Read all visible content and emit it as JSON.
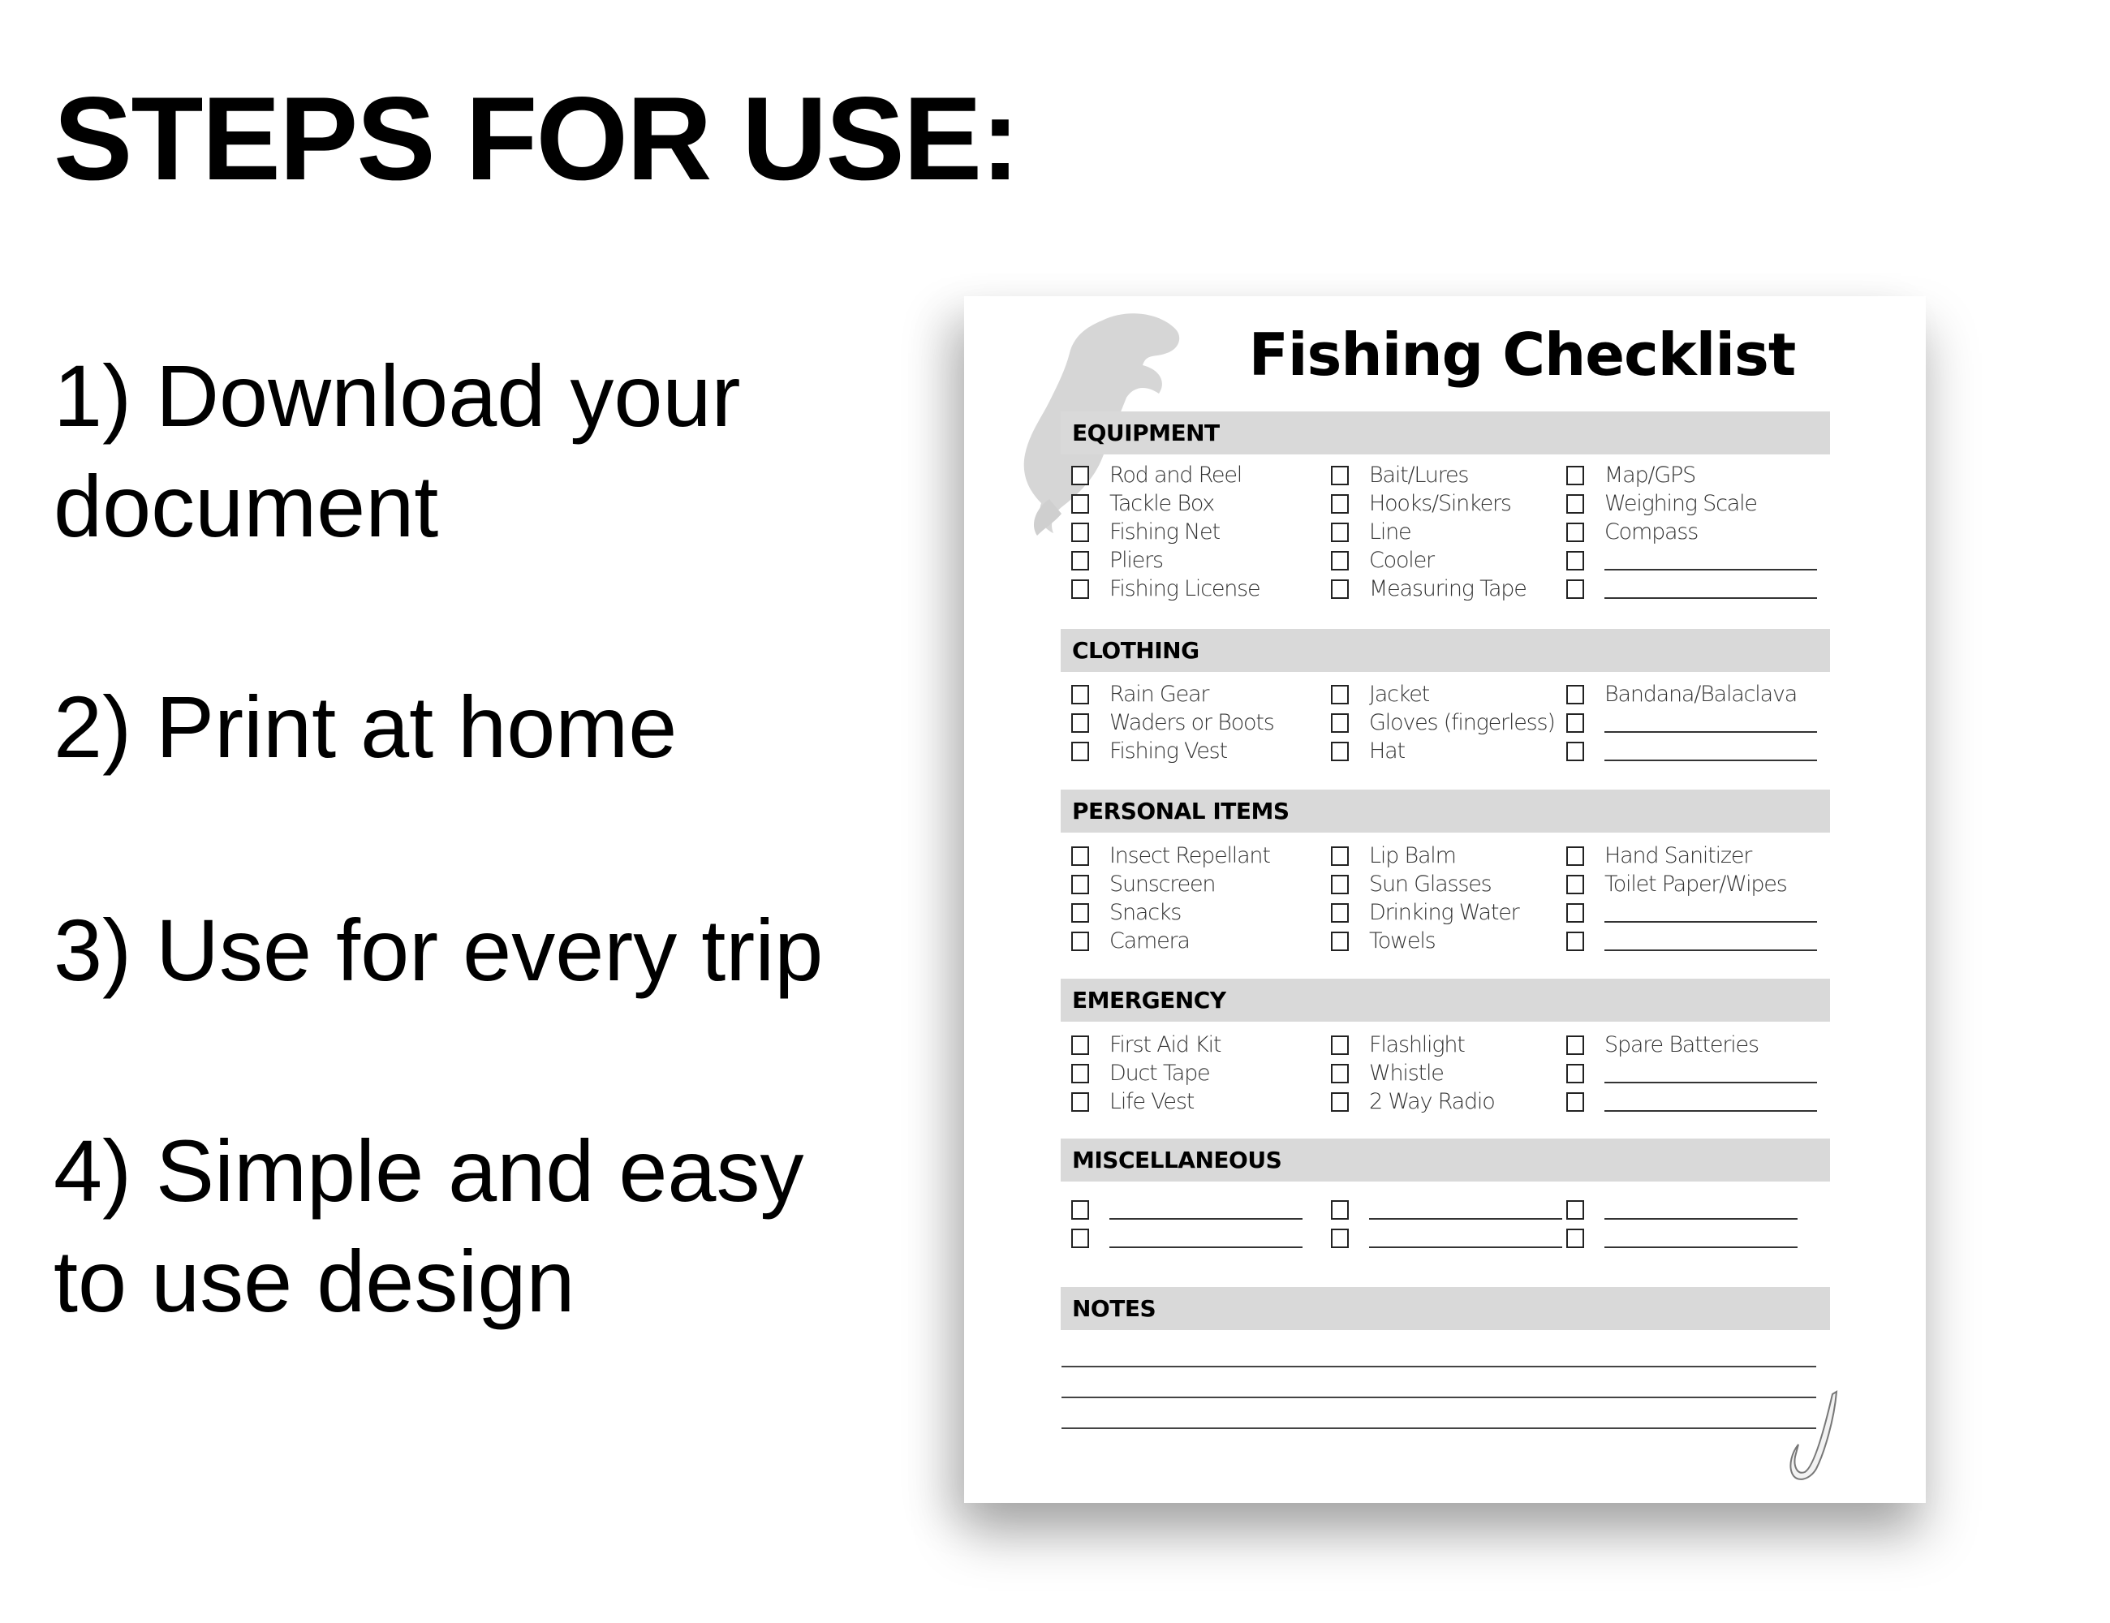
{
  "steps": {
    "title": "STEPS FOR USE:",
    "items": [
      {
        "line1": "1) Download your",
        "line2": "document"
      },
      {
        "line1": "2) Print at home",
        "line2": ""
      },
      {
        "line1": "3) Use for every trip",
        "line2": ""
      },
      {
        "line1": "4) Simple and easy",
        "line2": "to use design"
      }
    ]
  },
  "checklist": {
    "title": "Fishing Checklist",
    "sections": {
      "equipment": {
        "heading": "EQUIPMENT",
        "columns": [
          [
            "Rod and Reel",
            "Tackle Box",
            "Fishing Net",
            "Pliers",
            "Fishing License"
          ],
          [
            "Bait/Lures",
            "Hooks/Sinkers",
            "Line",
            "Cooler",
            "Measuring Tape"
          ],
          [
            "Map/GPS",
            "Weighing Scale",
            "Compass",
            "",
            ""
          ]
        ]
      },
      "clothing": {
        "heading": "CLOTHING",
        "columns": [
          [
            "Rain Gear",
            "Waders or Boots",
            "Fishing Vest"
          ],
          [
            "Jacket",
            "Gloves (fingerless)",
            "Hat"
          ],
          [
            "Bandana/Balaclava",
            "",
            ""
          ]
        ]
      },
      "personal": {
        "heading": "PERSONAL ITEMS",
        "columns": [
          [
            "Insect Repellant",
            "Sunscreen",
            "Snacks",
            "Camera"
          ],
          [
            "Lip Balm",
            "Sun Glasses",
            "Drinking Water",
            "Towels"
          ],
          [
            "Hand Sanitizer",
            "Toilet Paper/Wipes",
            "",
            ""
          ]
        ]
      },
      "emergency": {
        "heading": "EMERGENCY",
        "columns": [
          [
            "First Aid Kit",
            "Duct Tape",
            "Life Vest"
          ],
          [
            "Flashlight",
            "Whistle",
            "2 Way Radio"
          ],
          [
            "Spare Batteries",
            "",
            ""
          ]
        ]
      },
      "miscellaneous": {
        "heading": "MISCELLANEOUS",
        "columns": [
          [
            "",
            ""
          ],
          [
            "",
            ""
          ],
          [
            "",
            ""
          ]
        ]
      },
      "notes": {
        "heading": "NOTES",
        "line_count": 3
      }
    }
  },
  "icons": {
    "watermark": "fish-icon",
    "corner": "fishing-hook-icon"
  },
  "colors": {
    "section_bar": "#d9d9d9",
    "text": "#000000",
    "item_text": "#333333",
    "watermark": "#d6d6d6"
  }
}
